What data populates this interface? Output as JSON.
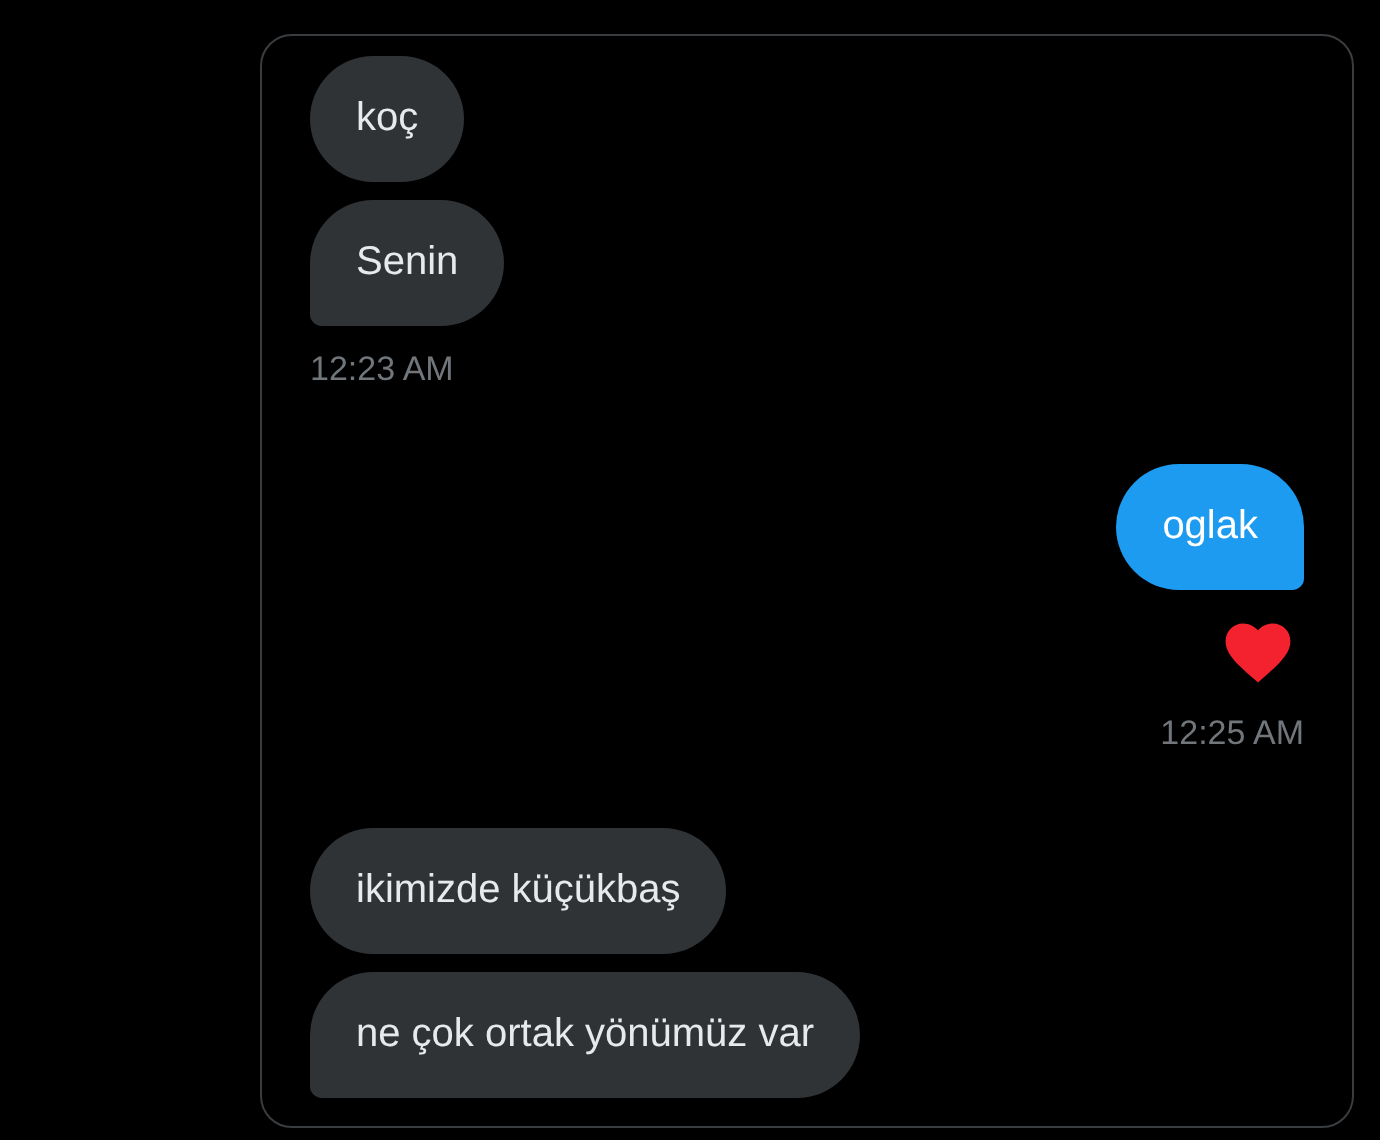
{
  "groups": [
    {
      "kind": "received",
      "messages": [
        {
          "text": "koç",
          "liked": false
        },
        {
          "text": "Senin",
          "liked": false
        }
      ],
      "time": "12:23 AM"
    },
    {
      "kind": "sent",
      "messages": [
        {
          "text": "oglak",
          "liked": true
        }
      ],
      "time": "12:25 AM"
    },
    {
      "kind": "received",
      "messages": [
        {
          "text": "ikimizde küçükbaş",
          "liked": false
        },
        {
          "text": "ne çok ortak yönümüz var",
          "liked": false
        }
      ]
    }
  ]
}
